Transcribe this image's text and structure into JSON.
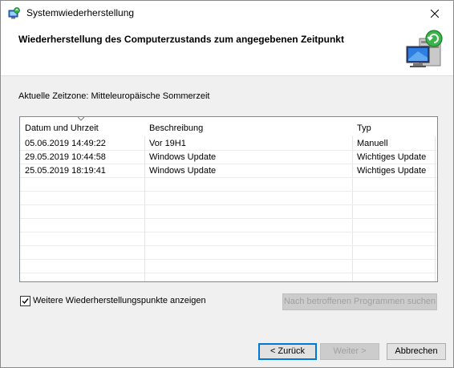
{
  "window": {
    "title": "Systemwiederherstellung"
  },
  "header": {
    "title": "Wiederherstellung des Computerzustands zum angegebenen Zeitpunkt"
  },
  "timezone_label": "Aktuelle Zeitzone: Mitteleuropäische Sommerzeit",
  "table": {
    "columns": [
      "Datum und Uhrzeit",
      "Beschreibung",
      "Typ"
    ],
    "sorted_column": "Datum und Uhrzeit",
    "rows": [
      {
        "date": "05.06.2019 14:49:22",
        "description": "Vor 19H1",
        "type": "Manuell"
      },
      {
        "date": "29.05.2019 10:44:58",
        "description": "Windows Update",
        "type": "Wichtiges Update"
      },
      {
        "date": "25.05.2019 18:19:41",
        "description": "Windows Update",
        "type": "Wichtiges Update"
      }
    ]
  },
  "show_more_checkbox": {
    "label": "Weitere Wiederherstellungspunkte anzeigen",
    "checked": true
  },
  "buttons": {
    "affected_programs": "Nach betroffenen Programmen suchen",
    "back": "< Zurück",
    "next": "Weiter >",
    "cancel": "Abbrechen"
  },
  "colors": {
    "accent": "#0078d7",
    "disabled_text": "#a0a0a0"
  },
  "icons": {
    "title": "system-restore-icon",
    "header": "computer-restore-icon",
    "close": "close-icon",
    "sort": "sort-descending-icon",
    "check": "checkmark-icon"
  }
}
